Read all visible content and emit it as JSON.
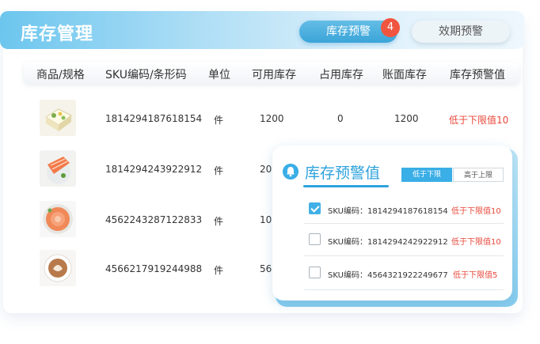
{
  "header": {
    "title": "库存管理",
    "tabs": [
      {
        "label": "库存预警",
        "badge": "4",
        "active": true
      },
      {
        "label": "效期预警",
        "active": false
      }
    ]
  },
  "table": {
    "columns": [
      "商品/规格",
      "SKU编码/条形码",
      "单位",
      "可用库存",
      "占用库存",
      "账面库存",
      "库存预警值"
    ],
    "rows": [
      {
        "thumb": "tofu-product-image",
        "sku": "1814294187618154",
        "unit": "件",
        "available": "1200",
        "occupied": "0",
        "book": "1200",
        "warning": "低于下限值10"
      },
      {
        "thumb": "salmon-fillet-image",
        "sku": "1814294243922912",
        "unit": "件",
        "available": "20"
      },
      {
        "thumb": "salmon-slices-image",
        "sku": "4562243287122833",
        "unit": "件",
        "available": "10"
      },
      {
        "thumb": "latte-cup-image",
        "sku": "4566217919244988",
        "unit": "件",
        "available": "56"
      }
    ]
  },
  "popup": {
    "title": "库存预警值",
    "tabs": [
      {
        "label": "低于下限",
        "active": true
      },
      {
        "label": "高于上限",
        "active": false
      }
    ],
    "items": [
      {
        "checked": true,
        "sku_label": "SKU编码：1814294187618154",
        "warning": "低于下限值10"
      },
      {
        "checked": false,
        "sku_label": "SKU编码：1814294242922912",
        "warning": "低于下限值10"
      },
      {
        "checked": false,
        "sku_label": "SKU编码：4564321922249677",
        "warning": "低于下限值5"
      }
    ]
  },
  "colors": {
    "accent": "#3aaee6",
    "badge": "#f0553f",
    "warning_text": "#e8473a"
  }
}
